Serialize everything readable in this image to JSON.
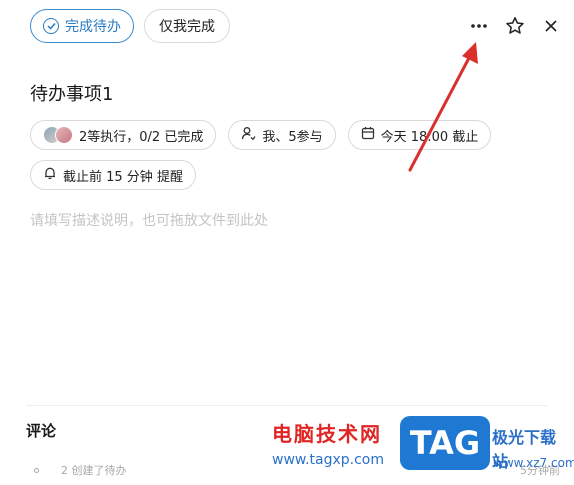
{
  "toolbar": {
    "complete_label": "完成待办",
    "only_me_label": "仅我完成"
  },
  "task": {
    "title": "待办事项1",
    "assignees_label": "2等执行，0/2 已完成",
    "participants_label": "我、5参与",
    "due_label": "今天 18:00 截止",
    "reminder_label": "截止前 15 分钟 提醒",
    "description_placeholder": "请填写描述说明，也可拖放文件到此处"
  },
  "comments": {
    "heading": "评论",
    "activity_text": "2 创建了待办",
    "activity_time": "5分钟前"
  },
  "watermark": {
    "site_cn": "电脑技术网",
    "site_url": "www.tagxp.com",
    "tag": "TAG",
    "site2": "极光下载站",
    "site2_url": "www.xz7.com"
  },
  "colors": {
    "accent": "#2a7dc4",
    "annotation_arrow": "#d9302c"
  }
}
